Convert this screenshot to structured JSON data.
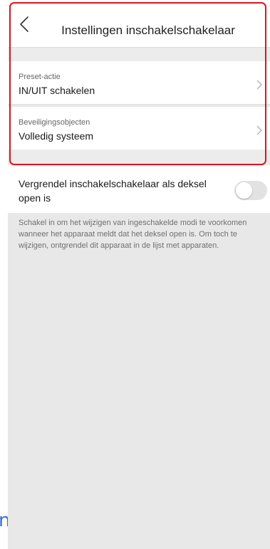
{
  "header": {
    "title": "Instellingen inschakelschakelaar"
  },
  "settings": {
    "rows": [
      {
        "label": "Preset-actie",
        "value": "IN/UIT schakelen"
      },
      {
        "label": "Beveiligingsobjecten",
        "value": "Volledig systeem"
      }
    ]
  },
  "lock_setting": {
    "label": "Vergrendel inschakelschakelaar als deksel open is",
    "enabled": false,
    "description": "Schakel in om het wijzigen van ingeschakelde modi te voorkomen wanneer het apparaat meldt dat het deksel open is. Om toch te wijzigen, ontgrendel dit apparaat in de lijst met apparaten."
  },
  "colors": {
    "highlight": "#e0111b",
    "background": "#e8e8e8"
  }
}
